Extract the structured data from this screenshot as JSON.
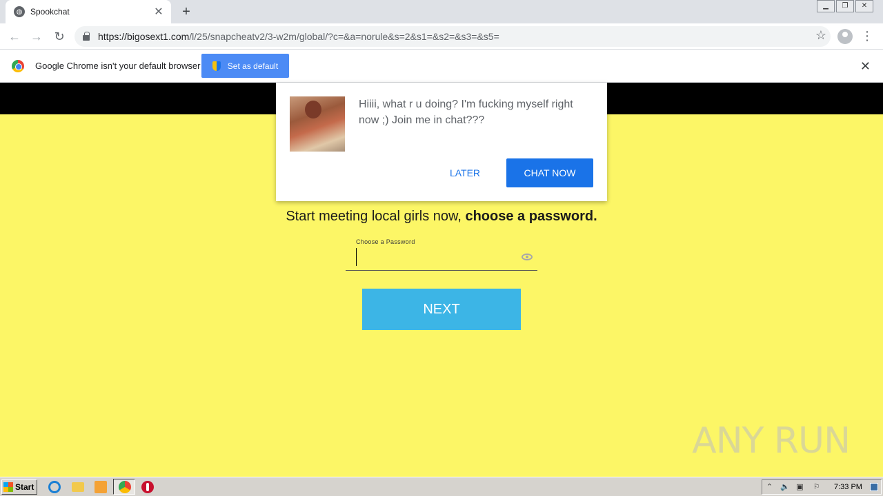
{
  "browser": {
    "tab_title": "Spookchat",
    "new_tab_symbol": "+",
    "url_host": "https://bigosext1.com",
    "url_path": "/l/25/snapcheatv2/3-w2m/global/?c=&a=norule&s=2&s1=&s2=&s3=&s5=",
    "infobar_text": "Google Chrome isn't your default browser",
    "infobar_button": "Set as default"
  },
  "popup": {
    "message": "Hiiii, what r u doing? I'm fucking myself right now ;) Join me in chat???",
    "later_label": "LATER",
    "chat_label": "CHAT NOW"
  },
  "page": {
    "headline_normal": "Start meeting local girls now, ",
    "headline_bold": "choose a password.",
    "password_label": "Choose a Password",
    "next_label": "NEXT",
    "watermark": "ANY RUN",
    "colors": {
      "background": "#fcf666",
      "next_button": "#3cb5e6",
      "chat_button": "#1a73e8"
    }
  },
  "taskbar": {
    "start_label": "Start",
    "clock": "7:33 PM"
  },
  "icons": [
    "globe-icon",
    "close-icon",
    "lock-icon",
    "star-icon",
    "profile-icon",
    "menu-icon",
    "chrome-logo-icon",
    "shield-icon",
    "eye-icon",
    "windows-logo-icon",
    "ie-icon",
    "folder-icon",
    "media-player-icon",
    "chrome-icon",
    "opera-icon"
  ]
}
